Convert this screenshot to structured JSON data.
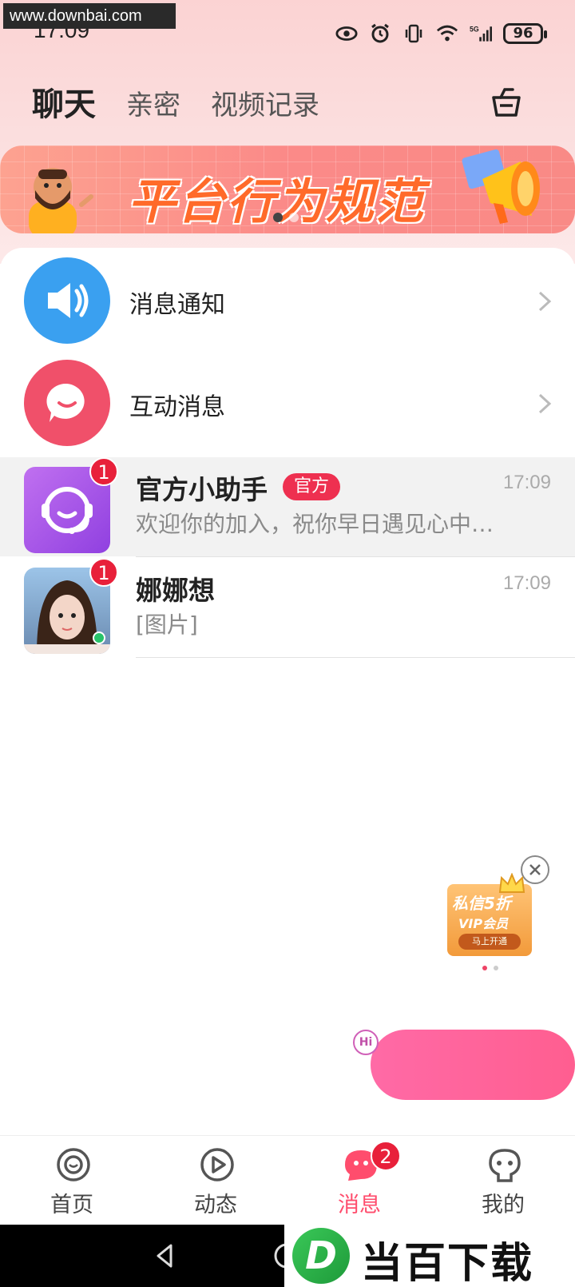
{
  "watermark": "www.downbai.com",
  "status_bar": {
    "time": "17:09",
    "battery": "96",
    "icons": [
      "eye-icon",
      "alarm-icon",
      "vibrate-icon",
      "wifi-icon",
      "signal-5g-icon",
      "battery-icon"
    ]
  },
  "header": {
    "tabs": [
      {
        "label": "聊天",
        "active": true
      },
      {
        "label": "亲密",
        "active": false
      },
      {
        "label": "视频记录",
        "active": false
      }
    ],
    "right_icon": "basket-icon"
  },
  "banner": {
    "title": "平台行为规范",
    "pages": 2,
    "active_page": 1
  },
  "notices": [
    {
      "label": "消息通知",
      "icon": "speaker-icon",
      "color": "#3aa0f0"
    },
    {
      "label": "互动消息",
      "icon": "chat-bubble-icon",
      "color": "#f0506a"
    }
  ],
  "conversations": [
    {
      "name": "官方小助手",
      "tag": "官方",
      "preview": "欢迎你的加入，祝你早日遇见心中…",
      "time": "17:09",
      "unread": "1",
      "avatar": "headset-smile-icon"
    },
    {
      "name": "娜娜想",
      "tag": "",
      "preview": "[图片]",
      "time": "17:09",
      "unread": "1",
      "avatar": "user-photo"
    }
  ],
  "vip_promo": {
    "title": "私信5折",
    "subtitle": "VIP会员",
    "cta": "马上开通"
  },
  "hi_bubble": "Hi",
  "bottom_nav": [
    {
      "label": "首页",
      "icon": "home-target-icon",
      "active": false,
      "badge": ""
    },
    {
      "label": "动态",
      "icon": "play-icon",
      "active": false,
      "badge": ""
    },
    {
      "label": "消息",
      "icon": "message-icon",
      "active": true,
      "badge": "2"
    },
    {
      "label": "我的",
      "icon": "profile-icon",
      "active": false,
      "badge": ""
    }
  ],
  "footer_logo": {
    "letter": "D",
    "text": "当百下载"
  },
  "colors": {
    "accent": "#ff4d6d",
    "badge": "#e8203a",
    "tag": "#ee3050",
    "header_bg": "#fbd3d3"
  }
}
